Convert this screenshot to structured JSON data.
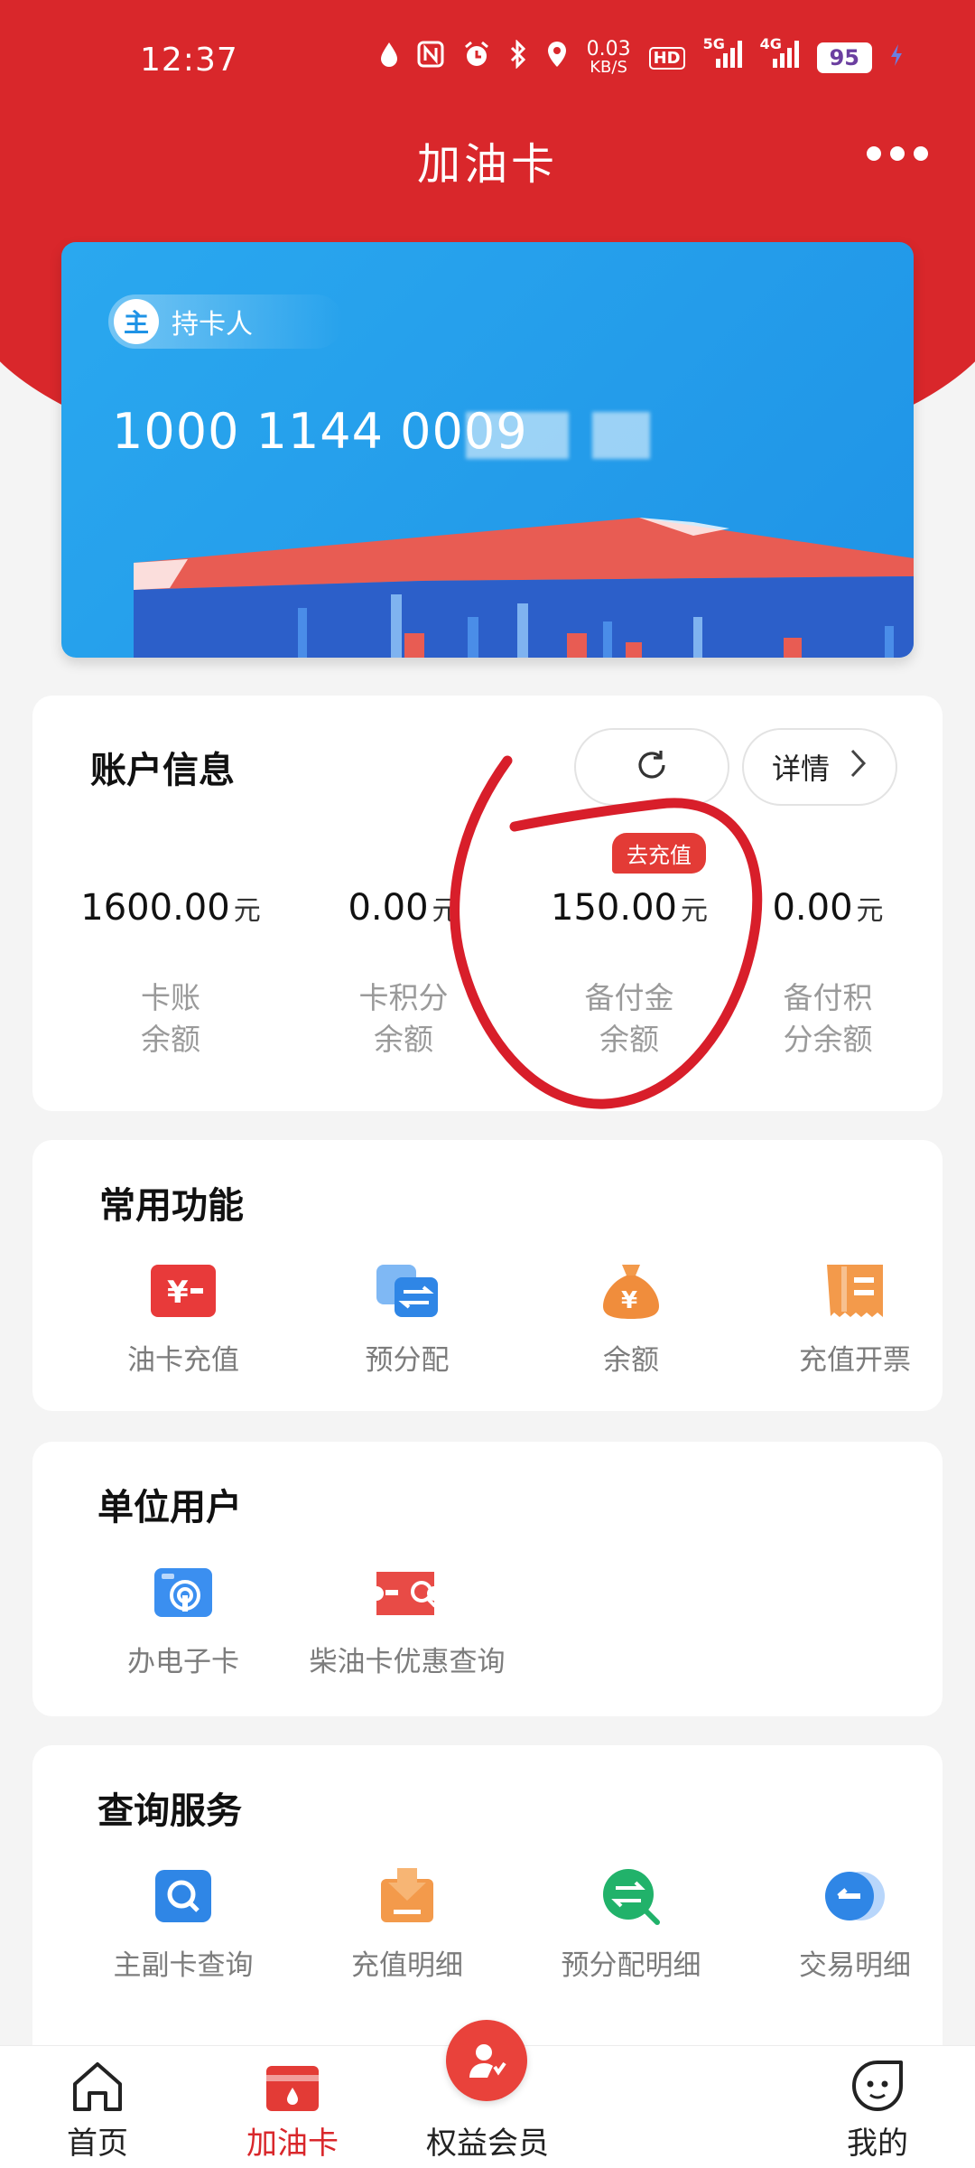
{
  "status_bar": {
    "time": "12:37",
    "net_speed_value": "0.03",
    "net_speed_unit": "KB/S",
    "hd_label": "HD",
    "net_5g": "5G",
    "net_4g": "4G",
    "battery": "95",
    "icons": [
      "drop-icon",
      "nfc-icon",
      "alarm-icon",
      "bluetooth-icon",
      "location-icon",
      "wifi-signal-icon",
      "cell-signal-icon",
      "charging-icon"
    ]
  },
  "header": {
    "title": "加油卡",
    "more_icon": "more-icon"
  },
  "card": {
    "holder_badge": "主",
    "holder_label": "持卡人",
    "number": "1000 1144 0009",
    "colors": {
      "card_bg": "#1f93e6",
      "canopy": "#e85c53",
      "canopy_under": "#2c5fc9"
    }
  },
  "account": {
    "title": "账户信息",
    "refresh_icon": "refresh-icon",
    "detail_label": "详情",
    "recharge_tag": "去充值",
    "stats": [
      {
        "value": "1600.00",
        "unit": "元",
        "label_line1": "卡账",
        "label_line2": "余额"
      },
      {
        "value": "0.00",
        "unit": "元",
        "label_line1": "卡积分",
        "label_line2": "余额"
      },
      {
        "value": "150.00",
        "unit": "元",
        "label_line1": "备付金",
        "label_line2": "余额"
      },
      {
        "value": "0.00",
        "unit": "元",
        "label_line1": "备付积",
        "label_line2": "分余额"
      }
    ]
  },
  "common_functions": {
    "title": "常用功能",
    "items": [
      {
        "label": "油卡充值",
        "icon": "yuan-card-icon"
      },
      {
        "label": "预分配",
        "icon": "transfer-icon"
      },
      {
        "label": "余额",
        "icon": "money-bag-icon"
      },
      {
        "label": "充值开票",
        "icon": "invoice-icon"
      }
    ]
  },
  "unit_users": {
    "title": "单位用户",
    "items": [
      {
        "label": "办电子卡",
        "icon": "e-card-icon"
      },
      {
        "label": "柴油卡优惠查询",
        "icon": "coupon-search-icon"
      }
    ]
  },
  "query_services": {
    "title": "查询服务",
    "items": [
      {
        "label": "主副卡查询",
        "icon": "search-card-icon"
      },
      {
        "label": "充值明细",
        "icon": "download-box-icon"
      },
      {
        "label": "预分配明细",
        "icon": "transfer-search-icon"
      },
      {
        "label": "交易明细",
        "icon": "transaction-icon"
      }
    ]
  },
  "bottom_nav": {
    "items": [
      {
        "label": "首页",
        "icon": "home-icon"
      },
      {
        "label": "加油卡",
        "icon": "card-icon"
      },
      {
        "label": "权益会员",
        "icon": "member-icon"
      },
      {
        "label": "我的",
        "icon": "profile-icon"
      }
    ],
    "active_index": 1,
    "colors": {
      "active": "#d9272b"
    }
  },
  "theme": {
    "brand_red": "#d9272b",
    "annotation_red": "#d81e2a"
  }
}
